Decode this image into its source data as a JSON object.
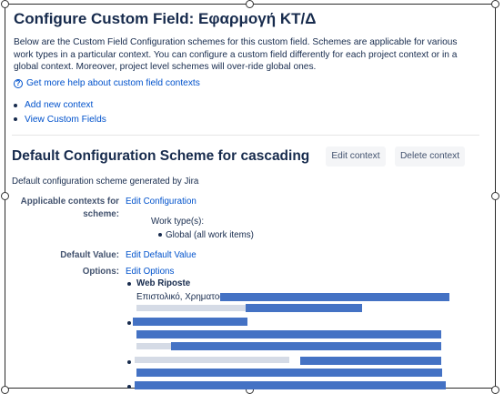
{
  "page": {
    "title": "Configure Custom Field: Εφαρμογή ΚΤ/Δ",
    "description": "Below are the Custom Field Configuration schemes for this custom field. Schemes are applicable for various work types in a particular context. You can configure a custom field differently for each project context or in a global context. Moreover, project level schemes will over-ride global ones.",
    "help_link": "Get more help about custom field contexts",
    "links": [
      "Add new context",
      "View Custom Fields"
    ]
  },
  "scheme": {
    "title": "Default Configuration Scheme for cascading",
    "edit_context": "Edit context",
    "delete_context": "Delete context",
    "generated": "Default configuration scheme generated by Jira",
    "applicable_label_line1": "Applicable contexts for",
    "applicable_label_line2": "scheme:",
    "edit_configuration": "Edit Configuration",
    "work_types_label": "Work type(s):",
    "work_types_value": "Global (all work items)",
    "default_value_label": "Default Value:",
    "edit_default_value": "Edit Default Value",
    "options_label": "Options:",
    "edit_options": "Edit Options",
    "options": [
      {
        "title": "Web Riposte",
        "sub": "Επιστολικό, Χρηματοοι"
      }
    ]
  },
  "colors": {
    "link": "#0052cc",
    "text": "#172b4d",
    "redaction": "#4472c4",
    "button_bg": "#f4f5f7"
  },
  "icons": [
    "help-circle-icon",
    "selection-handle-icon"
  ]
}
